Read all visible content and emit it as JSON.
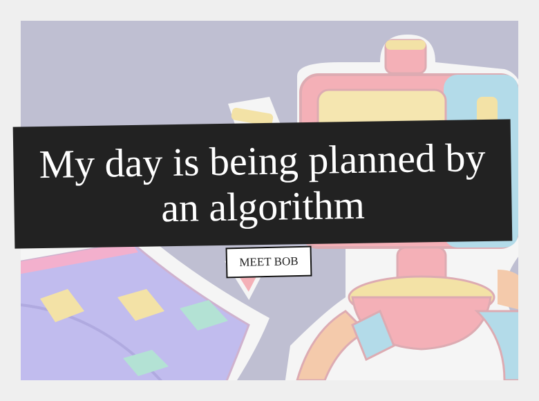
{
  "hero": {
    "headline": "My day is being planned by an algorithm",
    "cta_label": "MEET BOB"
  },
  "illustration": {
    "subject": "robot-with-calendar",
    "background_color": "#b7b7cc",
    "robot_pink": "#f3a6ae",
    "robot_yellow": "#f4e3a6",
    "robot_blue": "#a9d6e6",
    "calendar_purple": "#b9b3ec",
    "calendar_pink": "#f2a6c6",
    "tile_yellow": "#f2df9a",
    "tile_green": "#a9dfcf",
    "outline_white": "#f4f4f4",
    "band_color": "#222222"
  }
}
